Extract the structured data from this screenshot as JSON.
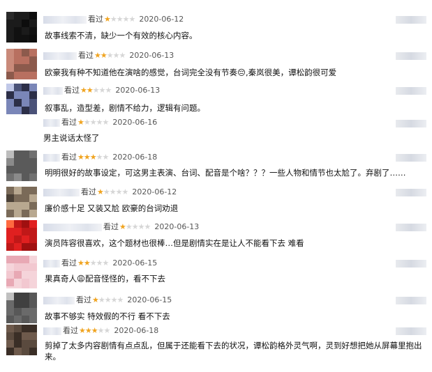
{
  "seen_label": "看过",
  "colors": {
    "star_on": "#f0a420",
    "star_off": "#d6d6d6"
  },
  "comments": [
    {
      "rating": 1,
      "date": "2020-06-12",
      "content": "故事线索不清，缺少一个有效的核心内容。"
    },
    {
      "rating": 2,
      "date": "2020-06-13",
      "content": "欧豪我有种不知道他在演啥的感觉，台词完全没有节奏😔,秦岚很美，谭松韵很可爱"
    },
    {
      "rating": 2,
      "date": "2020-06-13",
      "content": "叙事乱，造型差，剧情不给力，逻辑有问题。"
    },
    {
      "rating": 1,
      "date": "2020-06-16",
      "content": "男主说话太怪了"
    },
    {
      "rating": 3,
      "date": "2020-06-18",
      "content": "明明很好的故事设定，可这男主表演、台词、配音是个啥？？？一些人物和情节也太尬了。弃剧了……"
    },
    {
      "rating": 1,
      "date": "2020-06-12",
      "content": "廉价感十足 又装又尬 欧豪的台词劝退"
    },
    {
      "rating": 1,
      "date": "2020-06-13",
      "content": "演员阵容很喜欢，这个题材也很棒…但是剧情实在是让人不能看下去 难看"
    },
    {
      "rating": 2,
      "date": "2020-06-15",
      "content": "果真奇人😩配音怪怪的，看不下去"
    },
    {
      "rating": 1,
      "date": "2020-06-15",
      "content": "故事不够实 特效假的不行 看不下去"
    },
    {
      "rating": 3,
      "date": "2020-06-18",
      "content": "剪掉了太多内容剧情有点点乱，但属于还能看下去的状况，谭松韵格外灵气啊，灵到好想把她从屏幕里抱出来。"
    }
  ]
}
